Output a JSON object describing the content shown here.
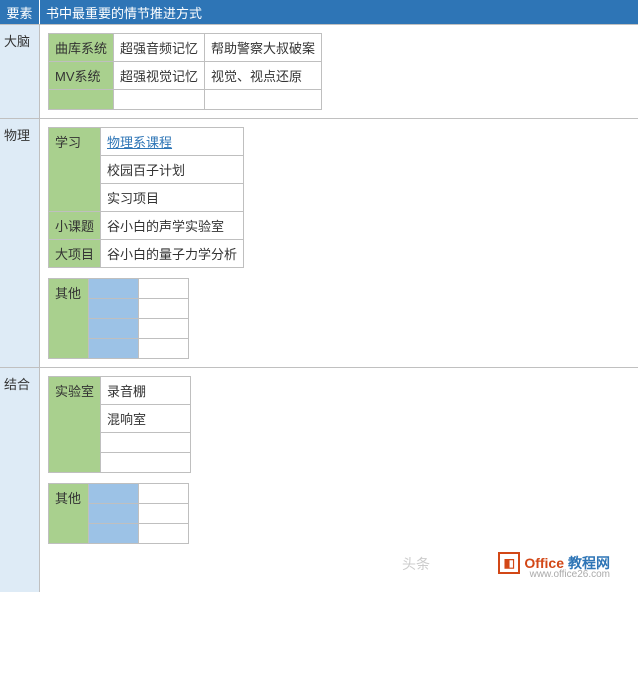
{
  "header": {
    "label": "要素",
    "value": "书中最重要的情节推进方式"
  },
  "sections": [
    {
      "label": "大脑",
      "rows": [
        {
          "h": "曲库系统",
          "c1": "超强音频记忆",
          "c2": "帮助警察大叔破案"
        },
        {
          "h": "MV系统",
          "c1": "超强视觉记忆",
          "c2": "视觉、视点还原"
        },
        {
          "h": "",
          "c1": "",
          "c2": ""
        }
      ]
    },
    {
      "label": "物理",
      "study_label": "学习",
      "study_items": [
        "物理系课程",
        "校园百子计划",
        "实习项目"
      ],
      "sub_topic": {
        "label": "小课题",
        "value": "谷小白的声学实验室"
      },
      "big_project": {
        "label": "大项目",
        "value": "谷小白的量子力学分析"
      },
      "other_label": "其他"
    },
    {
      "label": "结合",
      "lab_label": "实验室",
      "lab_items": [
        "录音棚",
        "混响室"
      ],
      "other_label": "其他"
    }
  ],
  "watermark": {
    "brand1": "Office",
    "brand2": "教程网",
    "url": "www.office26.com",
    "faint": "头条"
  }
}
